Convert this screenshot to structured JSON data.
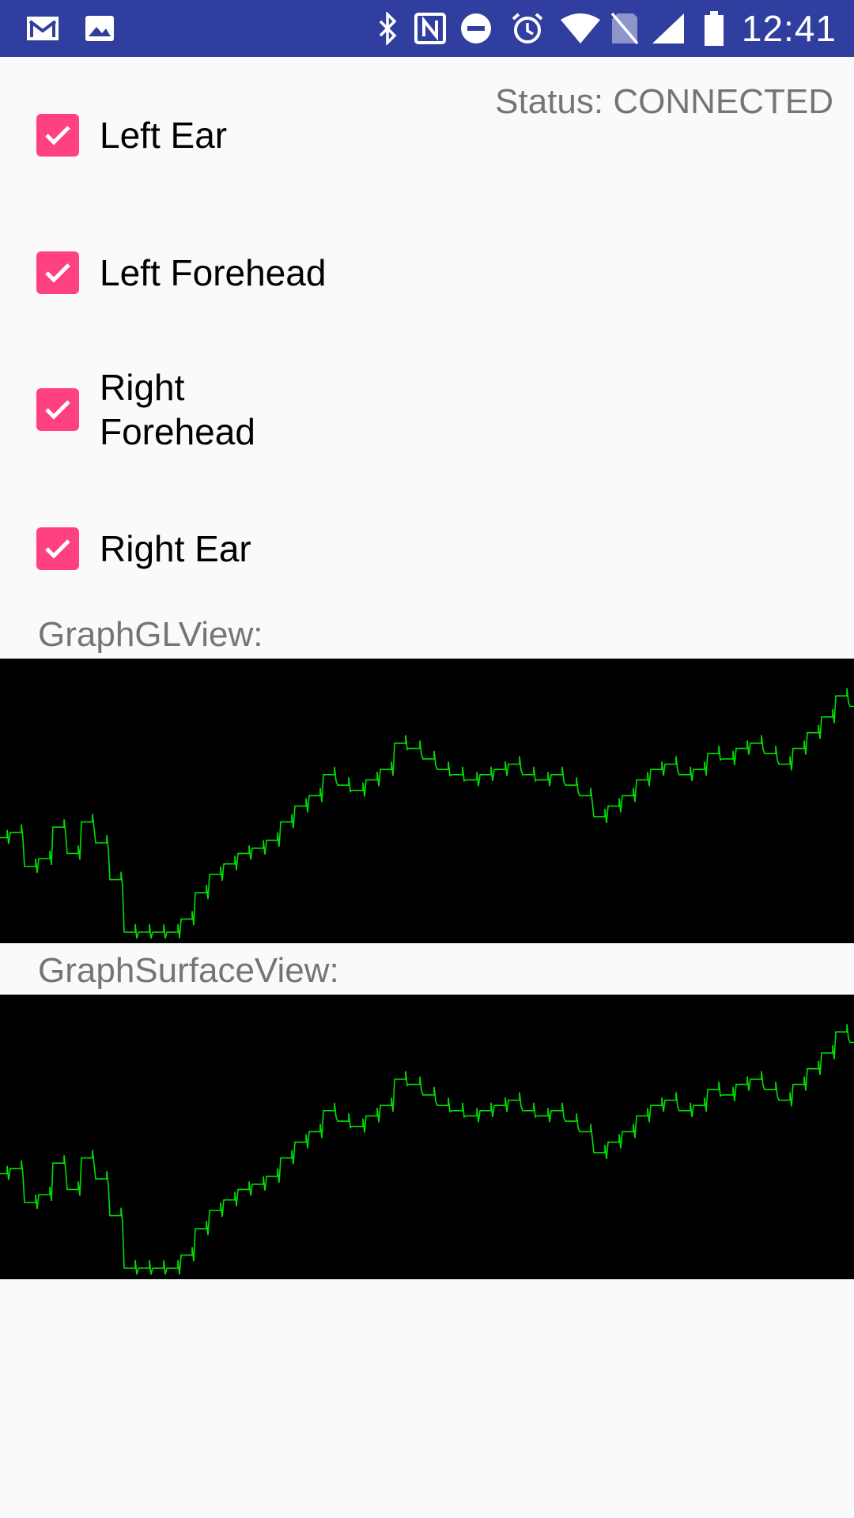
{
  "statusbar": {
    "time": "12:41",
    "colors": {
      "background": "#303f9f",
      "foreground": "#ffffff"
    },
    "left_icons": [
      "gmail-icon",
      "image-icon"
    ],
    "right_icons": [
      "bluetooth-icon",
      "nfc-icon",
      "do-not-disturb-icon",
      "alarm-icon",
      "wifi-icon",
      "no-sim-icon",
      "signal-icon",
      "battery-icon"
    ]
  },
  "status": {
    "text": "Status: CONNECTED"
  },
  "checkboxes": [
    {
      "label": "Left Ear",
      "checked": true
    },
    {
      "label": "Left Forehead",
      "checked": true
    },
    {
      "label": "Right Forehead",
      "checked": true
    },
    {
      "label": "Right Ear",
      "checked": true
    }
  ],
  "colors": {
    "checkbox": "#ff4081",
    "graph_background": "#000000",
    "graph_line": "#00e000"
  },
  "graphs": [
    {
      "label": "GraphGLView:"
    },
    {
      "label": "GraphSurfaceView:"
    }
  ],
  "chart_data": {
    "type": "line",
    "x": [
      0,
      1,
      2,
      3,
      4,
      5,
      6,
      7,
      8,
      9,
      10,
      11,
      12,
      13,
      14,
      15,
      16,
      17,
      18,
      19,
      20,
      21,
      22,
      23,
      24,
      25,
      26,
      27,
      28,
      29,
      30,
      31,
      32,
      33,
      34,
      35,
      36,
      37,
      38,
      39,
      40,
      41,
      42,
      43,
      44,
      45,
      46,
      47,
      48,
      49,
      50,
      51,
      52,
      53,
      54,
      55,
      56,
      57,
      58,
      59,
      60
    ],
    "values": [
      0.36,
      0.38,
      0.25,
      0.28,
      0.4,
      0.3,
      0.42,
      0.34,
      0.2,
      0,
      0,
      0,
      0,
      0.05,
      0.15,
      0.22,
      0.26,
      0.3,
      0.32,
      0.35,
      0.42,
      0.48,
      0.52,
      0.6,
      0.56,
      0.54,
      0.58,
      0.62,
      0.72,
      0.7,
      0.66,
      0.62,
      0.6,
      0.58,
      0.6,
      0.62,
      0.64,
      0.6,
      0.58,
      0.6,
      0.56,
      0.52,
      0.44,
      0.48,
      0.52,
      0.58,
      0.62,
      0.64,
      0.6,
      0.62,
      0.68,
      0.66,
      0.7,
      0.72,
      0.68,
      0.64,
      0.7,
      0.76,
      0.82,
      0.9,
      0.86
    ],
    "ylim": [
      0,
      1
    ]
  }
}
